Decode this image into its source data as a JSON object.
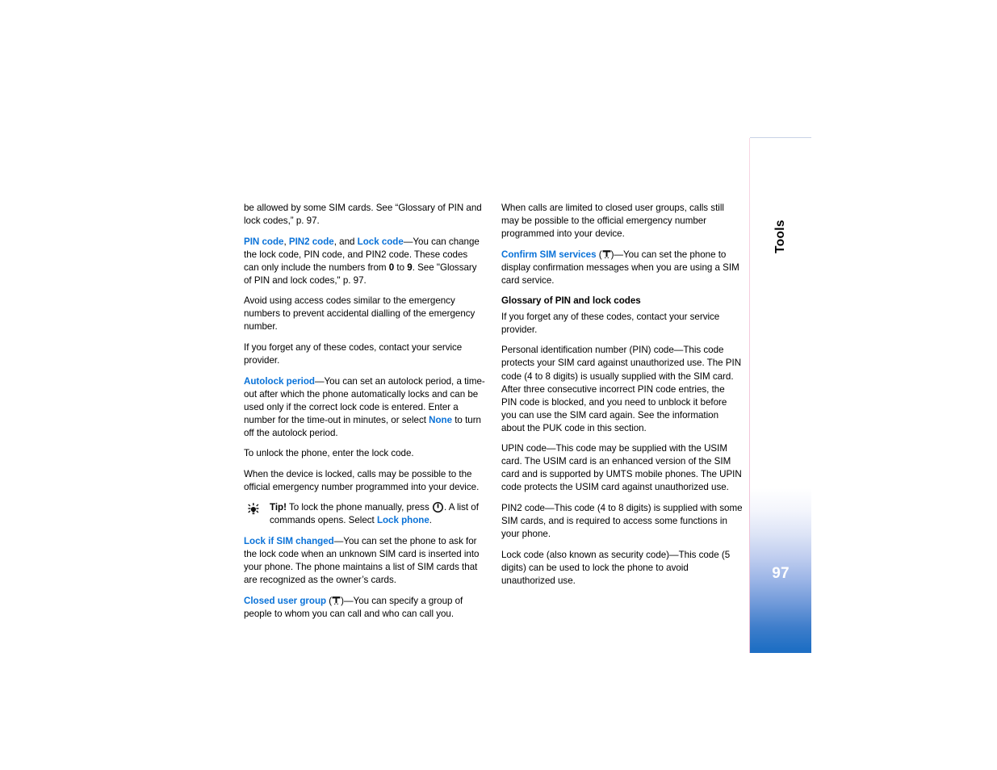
{
  "document": {
    "page_number": "97",
    "side_tab_label": "Tools",
    "link_color": "#0a72d8",
    "tab_gradient_bottom_color": "#1f6fc4"
  },
  "left_column": {
    "paragraphs": [
      {
        "id": "p1",
        "parts": [
          {
            "type": "text",
            "text": "be allowed by some SIM cards. See “Glossary of PIN and lock codes,” p. 97."
          }
        ]
      },
      {
        "id": "p2",
        "parts": [
          {
            "type": "link",
            "text": "PIN code"
          },
          {
            "type": "text",
            "text": ", "
          },
          {
            "type": "link",
            "text": "PIN2 code"
          },
          {
            "type": "text",
            "text": ", and "
          },
          {
            "type": "link",
            "text": "Lock code"
          },
          {
            "type": "text",
            "text": "—You can change the lock code, PIN code, and PIN2 code. These codes can only include the numbers from "
          },
          {
            "type": "bold",
            "text": "0"
          },
          {
            "type": "text",
            "text": " to "
          },
          {
            "type": "bold",
            "text": "9"
          },
          {
            "type": "text",
            "text": ". See \"Glossary of PIN and lock codes,\" p. 97."
          }
        ]
      },
      {
        "id": "p3",
        "parts": [
          {
            "type": "text",
            "text": "Avoid using access codes similar to the emergency numbers to prevent accidental dialling of the emergency number."
          }
        ]
      },
      {
        "id": "p4",
        "parts": [
          {
            "type": "text",
            "text": "If you forget any of these codes, contact your service provider."
          }
        ]
      },
      {
        "id": "p5",
        "parts": [
          {
            "type": "link",
            "text": "Autolock period"
          },
          {
            "type": "text",
            "text": "—You can set an autolock period, a time-out after which the phone automatically locks and can be used only if the correct lock code is entered. Enter a number for the time-out in minutes, or select "
          },
          {
            "type": "link",
            "text": "None"
          },
          {
            "type": "text",
            "text": " to turn off the autolock period."
          }
        ]
      },
      {
        "id": "p6",
        "parts": [
          {
            "type": "text",
            "text": "To unlock the phone, enter the lock code."
          }
        ]
      },
      {
        "id": "p7",
        "parts": [
          {
            "type": "text",
            "text": "When the device is locked, calls  may be possible to the official emergency number programmed into your device."
          }
        ]
      }
    ],
    "tip": {
      "icon": "lightbulb-tip-icon",
      "parts": [
        {
          "type": "bold",
          "text": "Tip!"
        },
        {
          "type": "text",
          "text": " To lock the phone manually, press "
        },
        {
          "type": "icon",
          "icon": "power-button-icon"
        },
        {
          "type": "text",
          "text": ". A list of commands opens. Select "
        },
        {
          "type": "link",
          "text": "Lock phone"
        },
        {
          "type": "text",
          "text": "."
        }
      ]
    },
    "paragraphs_after_tip": [
      {
        "id": "p8",
        "parts": [
          {
            "type": "link",
            "text": "Lock if SIM changed"
          },
          {
            "type": "text",
            "text": "—You can set the phone to ask for the lock code when an unknown SIM card is inserted into your phone. The phone maintains a list of SIM cards that are recognized as the owner’s cards."
          }
        ]
      },
      {
        "id": "p9",
        "parts": [
          {
            "type": "link",
            "text": "Closed user group"
          },
          {
            "type": "text",
            "text": " ("
          },
          {
            "type": "icon",
            "icon": "network-antenna-icon"
          },
          {
            "type": "text",
            "text": ")—You can specify a group of people to whom you can call and who can call you."
          }
        ]
      }
    ]
  },
  "right_column": {
    "paragraphs_before_heading": [
      {
        "id": "r1",
        "parts": [
          {
            "type": "text",
            "text": "When calls are limited to closed user groups, calls still may be possible to the official emergency number programmed into your device."
          }
        ]
      },
      {
        "id": "r2",
        "parts": [
          {
            "type": "link",
            "text": "Confirm SIM services"
          },
          {
            "type": "text",
            "text": " ("
          },
          {
            "type": "icon",
            "icon": "network-antenna-icon"
          },
          {
            "type": "text",
            "text": ")—You can set the phone to display confirmation messages when you are using a SIM card service."
          }
        ]
      }
    ],
    "heading": "Glossary of PIN and lock codes",
    "paragraphs_after_heading": [
      {
        "id": "r3",
        "parts": [
          {
            "type": "text",
            "text": "If you forget any of these codes, contact your service provider."
          }
        ]
      },
      {
        "id": "r4",
        "parts": [
          {
            "type": "text",
            "text": "Personal identification number (PIN) code—This code protects your SIM card against unauthorized use. The PIN code (4 to 8 digits) is usually supplied with the SIM card. After three consecutive incorrect PIN code entries, the PIN code is blocked, and you need to unblock it before you can use the SIM card again. See the information about the PUK code in this section."
          }
        ]
      },
      {
        "id": "r5",
        "parts": [
          {
            "type": "text",
            "text": "UPIN code—This code may be supplied with the USIM card. The USIM card is an enhanced version of the SIM card and is supported by UMTS mobile phones. The UPIN code protects the USIM card against unauthorized use."
          }
        ]
      },
      {
        "id": "r6",
        "parts": [
          {
            "type": "text",
            "text": "PIN2 code—This code (4 to 8 digits) is supplied with some SIM cards, and is required to access some functions in your phone."
          }
        ]
      },
      {
        "id": "r7",
        "parts": [
          {
            "type": "text",
            "text": "Lock code (also known as security code)—This code (5 digits) can be used to lock the phone to avoid unauthorized use."
          }
        ]
      }
    ]
  }
}
